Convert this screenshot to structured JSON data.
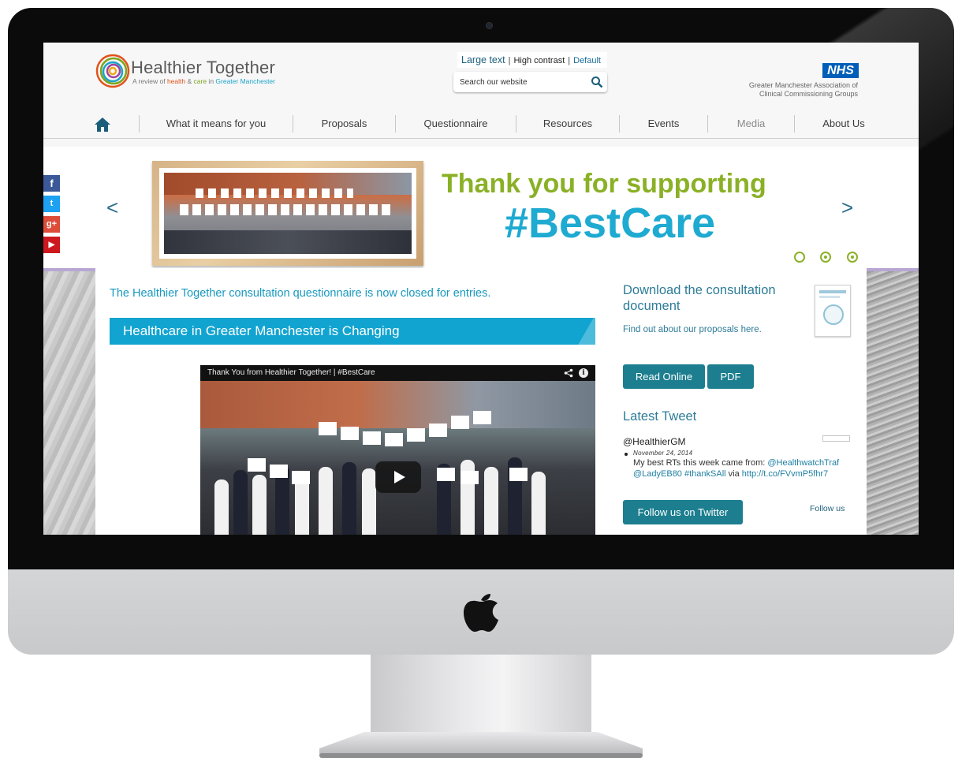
{
  "site": {
    "logo_title": "Healthier Together",
    "tagline_pre": "A review of ",
    "tagline_a": "health",
    "tagline_amp": " & ",
    "tagline_b": "care",
    "tagline_in": " in ",
    "tagline_c": "Greater Manchester"
  },
  "accessibility": {
    "large_text": "Large text",
    "high_contrast": "High contrast",
    "default": "Default",
    "separator": "|"
  },
  "search": {
    "placeholder": "Search our website"
  },
  "nhs": {
    "logo": "NHS",
    "line1": "Greater Manchester Association of",
    "line2": "Clinical Commissioning Groups"
  },
  "nav": {
    "items": [
      "What it means for you",
      "Proposals",
      "Questionnaire",
      "Resources",
      "Events",
      "Media",
      "About Us"
    ]
  },
  "social": [
    "f",
    "t",
    "g+",
    "▶"
  ],
  "banner": {
    "line1": "Thank you for supporting",
    "line2": "#BestCare",
    "prev": "<",
    "next": ">"
  },
  "main": {
    "closed_notice": "The Healthier Together consultation questionnaire is now closed for entries.",
    "heading_bar": "Healthcare in Greater Manchester is Changing",
    "video_title": "Thank You from Healthier Together! | #BestCare"
  },
  "download": {
    "title": "Download the consultation document",
    "subtitle": "Find out about our proposals here.",
    "read_online": "Read Online",
    "pdf": "PDF"
  },
  "tweets": {
    "heading": "Latest Tweet",
    "handle": "@HealthierGM",
    "date": "November 24, 2014",
    "text_pre": "My best RTs this week came from: ",
    "link1": "@HealthwatchTraf",
    "link2": "@LadyEB80",
    "link3": "#thankSAll",
    "via": " via ",
    "link4": "http://t.co/FVvmP5fhr7",
    "follow_button": "Follow us on Twitter",
    "follow_link": "Follow us"
  },
  "colors": {
    "accent_teal": "#1c7e8f",
    "banner_green": "#8ab126",
    "banner_blue": "#1eaad1",
    "heading_bar": "#12a4d0",
    "nhs_blue": "#005eb8"
  }
}
